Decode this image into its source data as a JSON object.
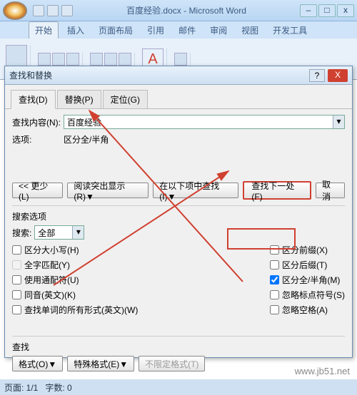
{
  "window": {
    "title": "百度经验.docx - Microsoft Word",
    "min": "–",
    "max": "□",
    "close": "x"
  },
  "ribbon": {
    "tabs": [
      "开始",
      "插入",
      "页面布局",
      "引用",
      "邮件",
      "审阅",
      "视图",
      "开发工具"
    ],
    "letterA": "A"
  },
  "dialog": {
    "title": "查找和替换",
    "help": "?",
    "close": "X",
    "tabs": {
      "find": "查找(D)",
      "replace": "替换(P)",
      "goto": "定位(G)"
    },
    "find_label": "查找内容(N):",
    "find_value": "百度经验",
    "options_label": "选项:",
    "options_value": "区分全/半角",
    "btn_less": "<< 更少(L)",
    "btn_highlight": "阅读突出显示(R)▼",
    "btn_findin": "在以下项中查找(I)▼",
    "btn_next": "查找下一处(F)",
    "btn_cancel": "取消",
    "searchopts_title": "搜索选项",
    "search_label": "搜索:",
    "search_value": "全部",
    "chk_case": "区分大小写(H)",
    "chk_whole": "全字匹配(Y)",
    "chk_wildcard": "使用通配符(U)",
    "chk_sounds": "同音(英文)(K)",
    "chk_forms": "查找单词的所有形式(英文)(W)",
    "chk_prefix": "区分前缀(X)",
    "chk_suffix": "区分后缀(T)",
    "chk_width": "区分全/半角(M)",
    "chk_punct": "忽略标点符号(S)",
    "chk_space": "忽略空格(A)",
    "find_section": "查找",
    "btn_format": "格式(O)▼",
    "btn_special": "特殊格式(E)▼",
    "btn_noformat": "不限定格式(T)"
  },
  "status": {
    "page": "页面: 1/1",
    "words": "字数: 0"
  },
  "watermark": "www.jb51.net"
}
